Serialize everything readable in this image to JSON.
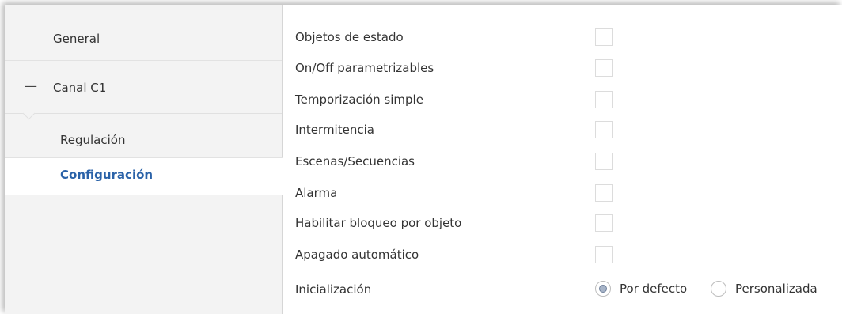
{
  "sidebar": {
    "general": "General",
    "collapse_symbol": "—",
    "canal": "Canal C1",
    "regulacion": "Regulación",
    "configuracion": "Configuración"
  },
  "settings": [
    {
      "label": "Objetos de estado",
      "checked": false
    },
    {
      "label": "On/Off parametrizables",
      "checked": false
    },
    {
      "label": "Temporización simple",
      "checked": false
    },
    {
      "label": "Intermitencia",
      "checked": false
    },
    {
      "label": "Escenas/Secuencias",
      "checked": false
    },
    {
      "label": "Alarma",
      "checked": false
    },
    {
      "label": "Habilitar bloqueo por objeto",
      "checked": false
    },
    {
      "label": "Apagado automático",
      "checked": false
    }
  ],
  "initialization": {
    "label": "Inicialización",
    "options": [
      {
        "label": "Por defecto",
        "selected": true
      },
      {
        "label": "Personalizada",
        "selected": false
      }
    ]
  },
  "colors": {
    "selected_nav_text": "#2a62a8",
    "sidebar_bg": "#f3f3f3"
  }
}
